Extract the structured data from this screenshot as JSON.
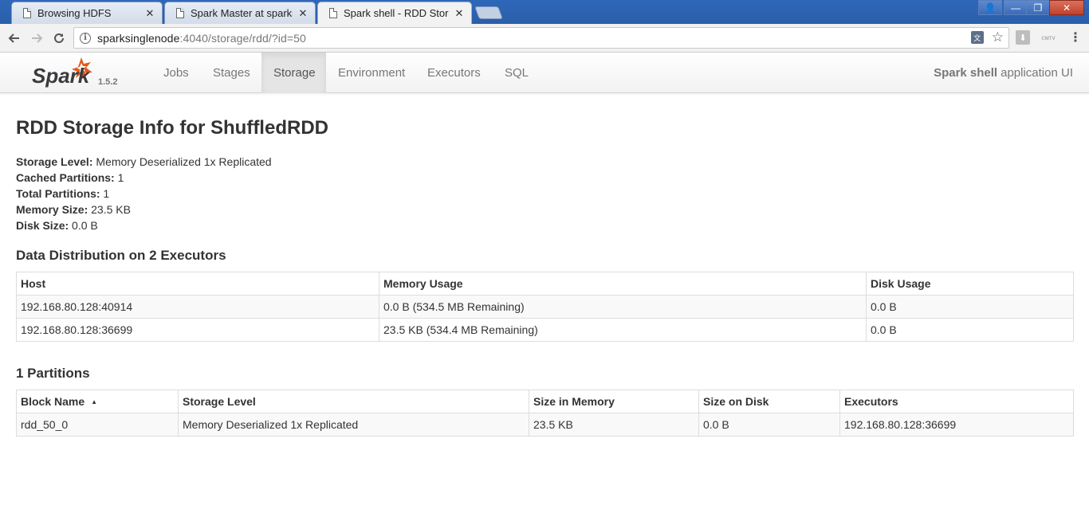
{
  "browser": {
    "tabs": [
      {
        "title": "Browsing HDFS",
        "active": false
      },
      {
        "title": "Spark Master at sparks",
        "active": false
      },
      {
        "title": "Spark shell - RDD Stora",
        "active": true
      }
    ],
    "tab_close_glyph": "✕",
    "window_controls": {
      "user": "👤",
      "minimize": "—",
      "maximize": "❐",
      "close": "✕"
    },
    "url_host": "sparksinglenode",
    "url_rest": ":4040/storage/rdd/?id=50",
    "extensions": {
      "ext2_label": "ᴄᴍᴛᴠ"
    }
  },
  "spark_nav": {
    "logo_text": "Spark",
    "version": "1.5.2",
    "items": [
      {
        "label": "Jobs"
      },
      {
        "label": "Stages"
      },
      {
        "label": "Storage",
        "active": true
      },
      {
        "label": "Environment"
      },
      {
        "label": "Executors"
      },
      {
        "label": "SQL"
      }
    ],
    "app_name": "Spark shell",
    "app_suffix": "application UI"
  },
  "page": {
    "title": "RDD Storage Info for ShuffledRDD",
    "summary": [
      {
        "key": "Storage Level:",
        "value": "Memory Deserialized 1x Replicated"
      },
      {
        "key": "Cached Partitions:",
        "value": "1"
      },
      {
        "key": "Total Partitions:",
        "value": "1"
      },
      {
        "key": "Memory Size:",
        "value": "23.5 KB"
      },
      {
        "key": "Disk Size:",
        "value": "0.0 B"
      }
    ]
  },
  "distribution": {
    "heading": "Data Distribution on 2 Executors",
    "columns": [
      "Host",
      "Memory Usage",
      "Disk Usage"
    ],
    "rows": [
      [
        "192.168.80.128:40914",
        "0.0 B (534.5 MB Remaining)",
        "0.0 B"
      ],
      [
        "192.168.80.128:36699",
        "23.5 KB (534.4 MB Remaining)",
        "0.0 B"
      ]
    ]
  },
  "partitions": {
    "heading": "1 Partitions",
    "columns": [
      "Block Name",
      "Storage Level",
      "Size in Memory",
      "Size on Disk",
      "Executors"
    ],
    "sort_indicator": "▲",
    "rows": [
      [
        "rdd_50_0",
        "Memory Deserialized 1x Replicated",
        "23.5 KB",
        "0.0 B",
        "192.168.80.128:36699"
      ]
    ]
  },
  "colors": {
    "spark_orange": "#E25A1C",
    "spark_text": "#3C3A3E",
    "nav_active_bg": "#E5E5E5",
    "stripe_bg": "#F9F9F9"
  }
}
